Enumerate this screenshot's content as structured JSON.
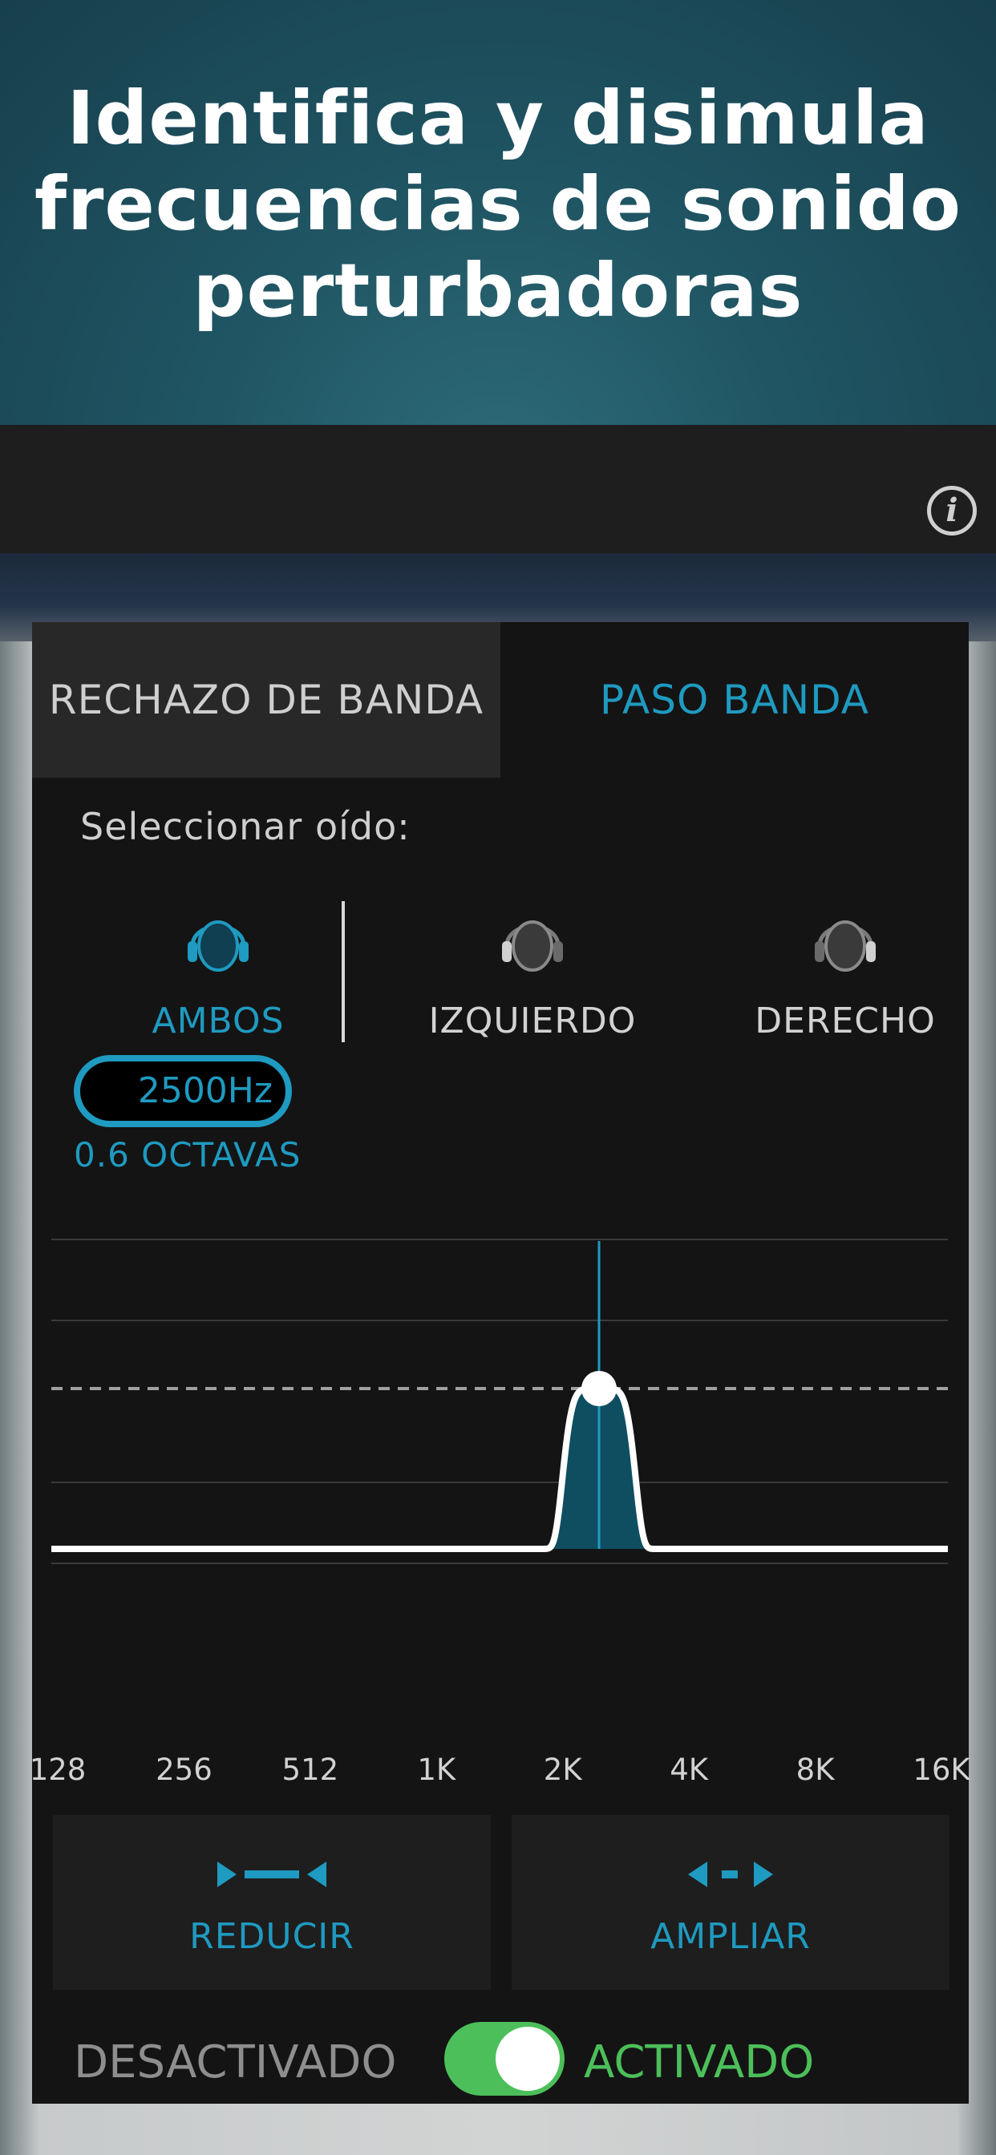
{
  "hero": {
    "title": "Identifica y disimula frecuencias de sonido perturbadoras"
  },
  "topbar": {
    "info_icon": "info-icon",
    "info_glyph": "i"
  },
  "tabs": [
    {
      "label": "RECHAZO DE BANDA",
      "active": false
    },
    {
      "label": "PASO BANDA",
      "active": true
    }
  ],
  "ear_select": {
    "label": "Seleccionar oído:",
    "options": [
      {
        "label": "AMBOS",
        "icon": "headphones-head-icon",
        "selected": true
      },
      {
        "label": "IZQUIERDO",
        "icon": "headphones-head-left-icon",
        "selected": false
      },
      {
        "label": "DERECHO",
        "icon": "headphones-head-right-icon",
        "selected": false
      }
    ]
  },
  "filter": {
    "frequency": "2500Hz",
    "bandwidth": "0.6 OCTAVAS"
  },
  "chart_data": {
    "type": "line",
    "x_scale": "log2",
    "x_ticks": [
      "128",
      "256",
      "512",
      "1K",
      "2K",
      "4K",
      "8K",
      "16K"
    ],
    "center_frequency_hz": 2500,
    "bandwidth_octaves": 0.6,
    "grid": true,
    "reference_line": "dashed"
  },
  "buttons": {
    "reduce": {
      "label": "REDUCIR",
      "icon": "narrow-arrows-icon"
    },
    "expand": {
      "label": "AMPLIAR",
      "icon": "widen-arrows-icon"
    }
  },
  "toggle": {
    "off_label": "DESACTIVADO",
    "on_label": "ACTIVADO",
    "on": true
  },
  "colors": {
    "accent": "#1f9ac0",
    "active_green": "#4cbf5a",
    "panel": "#141414"
  }
}
